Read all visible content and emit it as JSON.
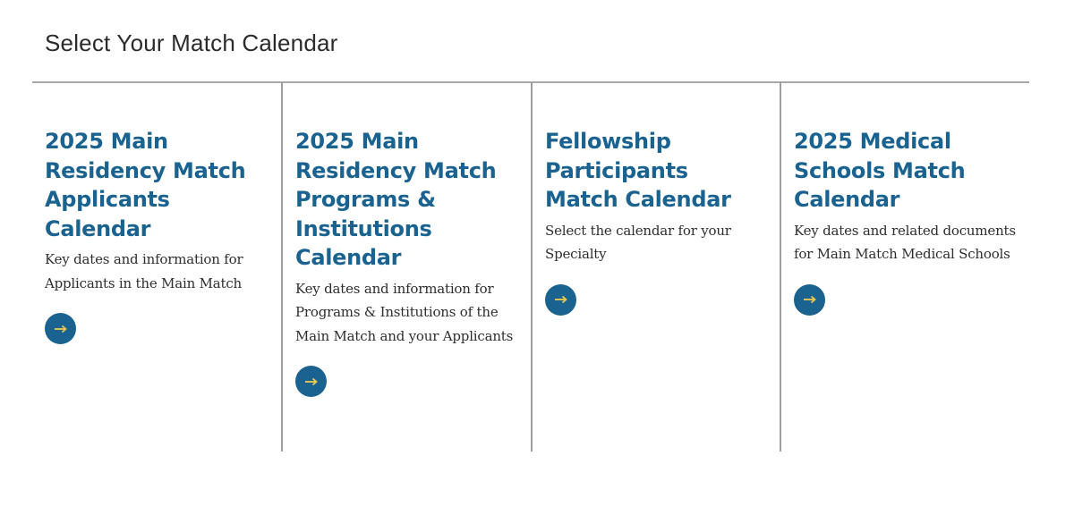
{
  "section": {
    "title": "Select Your Match Calendar"
  },
  "colors": {
    "accent": "#1a6390",
    "arrow": "#f2c94c",
    "divider": "#a8a8a8"
  },
  "cards": [
    {
      "title": "2025 Main Residency Match Applicants Calendar",
      "description": "Key dates and information for Applicants in the Main Match",
      "button_icon": "arrow-right-icon"
    },
    {
      "title": "2025 Main Residency Match Programs & Institutions Calendar",
      "description": "Key dates and information for Programs & Institutions of the Main Match and your Applicants",
      "button_icon": "arrow-right-icon"
    },
    {
      "title": "Fellowship Participants Match Calendar",
      "description": "Select the calendar for your Specialty",
      "button_icon": "arrow-right-icon"
    },
    {
      "title": "2025 Medical Schools Match Calendar",
      "description": "Key dates and related documents for Main Match Medical Schools",
      "button_icon": "arrow-right-icon"
    }
  ]
}
